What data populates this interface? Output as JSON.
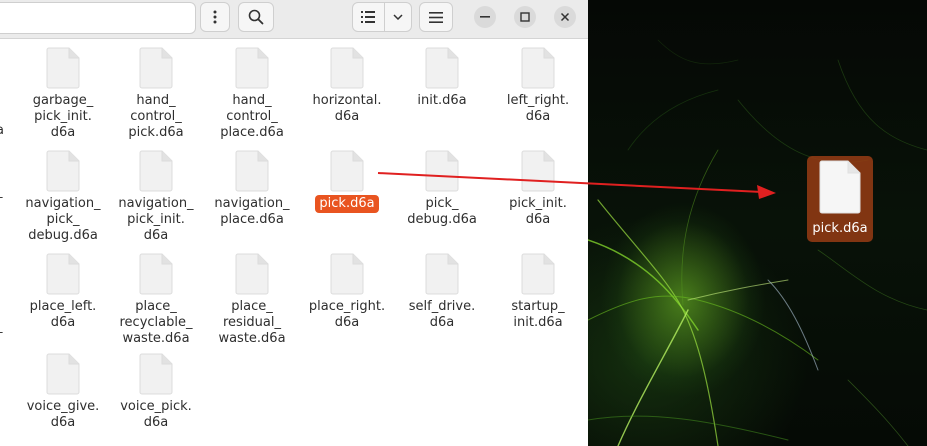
{
  "files": [
    {
      "id": "garbage",
      "name": "garbage_\npick_init.\nd6a"
    },
    {
      "id": "hand-control-pick",
      "name": "hand_\ncontrol_\npick.d6a"
    },
    {
      "id": "hand-control-place",
      "name": "hand_\ncontrol_\nplace.d6a"
    },
    {
      "id": "horizontal",
      "name": "horizontal.\nd6a"
    },
    {
      "id": "init",
      "name": "init.d6a"
    },
    {
      "id": "left-right",
      "name": "left_right.\nd6a"
    },
    {
      "id": "navigation-pick-debug",
      "name": "navigation_\npick_\ndebug.d6a"
    },
    {
      "id": "navigation-pick-init",
      "name": "navigation_\npick_init.\nd6a"
    },
    {
      "id": "navigation-place",
      "name": "navigation_\nplace.d6a"
    },
    {
      "id": "pick",
      "name": "pick.d6a"
    },
    {
      "id": "pick-debug",
      "name": "pick_\ndebug.d6a"
    },
    {
      "id": "pick-init",
      "name": "pick_init.\nd6a"
    },
    {
      "id": "place-left",
      "name": "place_left.\nd6a"
    },
    {
      "id": "place-recyclable-waste",
      "name": "place_\nrecyclable_\nwaste.d6a"
    },
    {
      "id": "place-residual-waste",
      "name": "place_\nresidual_\nwaste.d6a"
    },
    {
      "id": "place-right",
      "name": "place_right.\nd6a"
    },
    {
      "id": "self-drive",
      "name": "self_drive.\nd6a"
    },
    {
      "id": "startup-init",
      "name": "startup_\ninit.d6a"
    },
    {
      "id": "voice-give",
      "name": "voice_give.\nd6a"
    },
    {
      "id": "voice-pick",
      "name": "voice_pick.\nd6a"
    }
  ],
  "selected_file": "pick",
  "desktop": {
    "icon_label": "pick.d6a"
  },
  "icons": {
    "menu": "kebab-menu-icon",
    "search": "search-icon",
    "view_list": "list-view-icon",
    "view_options": "chevron-down-icon",
    "main_menu": "hamburger-menu-icon",
    "minimize": "minimize-icon",
    "maximize": "maximize-icon",
    "close": "close-icon"
  },
  "colors": {
    "selection": "#e95420",
    "arrow": "#e02020"
  }
}
